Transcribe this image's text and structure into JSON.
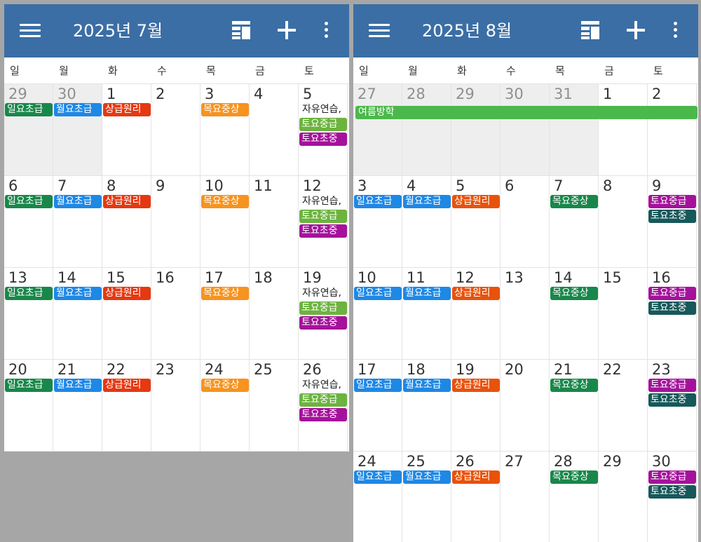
{
  "colors": {
    "app_bar": "#3b6ea5",
    "other_month_bg": "#eeeeee",
    "outer_bg": "#a6a6a6",
    "grid_line": "#e3e3e3"
  },
  "icons": [
    "menu-icon",
    "view-layout-icon",
    "add-icon",
    "more-vert-icon"
  ],
  "weekdays": [
    "일",
    "월",
    "화",
    "수",
    "목",
    "금",
    "토"
  ],
  "event_colors": {
    "일요초급": "#19874a",
    "월요초급": "#1e88e5",
    "상급원리": "#e53912",
    "목요중상": "#f7931e",
    "자유연습,": "#ffffff",
    "토요중급": "#6cb33f",
    "토요초중": "#a4129b",
    "여름방학": "#4bb84b"
  },
  "months": [
    {
      "title": "2025년 7월",
      "weeks": [
        [
          {
            "day": "29",
            "other": true,
            "events": [
              "일요초급"
            ]
          },
          {
            "day": "30",
            "other": true,
            "events": [
              "월요초급"
            ]
          },
          {
            "day": "1",
            "events": [
              "상급원리"
            ]
          },
          {
            "day": "2",
            "events": []
          },
          {
            "day": "3",
            "events": [
              "목요중상"
            ]
          },
          {
            "day": "4",
            "events": []
          },
          {
            "day": "5",
            "events": [
              "자유연습,",
              "토요중급",
              "토요초중"
            ]
          }
        ],
        [
          {
            "day": "6",
            "events": [
              "일요초급"
            ]
          },
          {
            "day": "7",
            "events": [
              "월요초급"
            ]
          },
          {
            "day": "8",
            "events": [
              "상급원리"
            ]
          },
          {
            "day": "9",
            "events": []
          },
          {
            "day": "10",
            "events": [
              "목요중상"
            ]
          },
          {
            "day": "11",
            "events": []
          },
          {
            "day": "12",
            "events": [
              "자유연습,",
              "토요중급",
              "토요초중"
            ]
          }
        ],
        [
          {
            "day": "13",
            "events": [
              "일요초급"
            ]
          },
          {
            "day": "14",
            "events": [
              "월요초급"
            ]
          },
          {
            "day": "15",
            "events": [
              "상급원리"
            ]
          },
          {
            "day": "16",
            "events": []
          },
          {
            "day": "17",
            "events": [
              "목요중상"
            ]
          },
          {
            "day": "18",
            "events": []
          },
          {
            "day": "19",
            "events": [
              "자유연습,",
              "토요중급",
              "토요초중"
            ]
          }
        ],
        [
          {
            "day": "20",
            "events": [
              "일요초급"
            ]
          },
          {
            "day": "21",
            "events": [
              "월요초급"
            ]
          },
          {
            "day": "22",
            "events": [
              "상급원리"
            ]
          },
          {
            "day": "23",
            "events": []
          },
          {
            "day": "24",
            "events": [
              "목요중상"
            ]
          },
          {
            "day": "25",
            "events": []
          },
          {
            "day": "26",
            "events": [
              "자유연습,",
              "토요중급",
              "토요초중"
            ]
          }
        ],
        [
          {
            "day": "",
            "events": []
          },
          {
            "day": "",
            "events": []
          },
          {
            "day": "",
            "events": []
          },
          {
            "day": "",
            "events": []
          },
          {
            "day": "",
            "events": []
          },
          {
            "day": "",
            "events": []
          },
          {
            "day": "",
            "events": []
          }
        ]
      ]
    },
    {
      "title": "2025년 8월",
      "spanning_event": {
        "label": "여름방학",
        "color": "#4bb84b"
      },
      "event_color_overrides": {
        "일요초급": "#1e88e5",
        "상급원리": "#e8520c",
        "목요중상": "#19874a",
        "토요중급": "#a4129b",
        "토요초중": "#17585a"
      },
      "weeks": [
        [
          {
            "day": "27",
            "other": true,
            "events": []
          },
          {
            "day": "28",
            "other": true,
            "events": []
          },
          {
            "day": "29",
            "other": true,
            "events": []
          },
          {
            "day": "30",
            "other": true,
            "events": []
          },
          {
            "day": "31",
            "other": true,
            "events": []
          },
          {
            "day": "1",
            "events": []
          },
          {
            "day": "2",
            "events": []
          }
        ],
        [
          {
            "day": "3",
            "events": [
              "일요초급"
            ]
          },
          {
            "day": "4",
            "events": [
              "월요초급"
            ]
          },
          {
            "day": "5",
            "events": [
              "상급원리"
            ]
          },
          {
            "day": "6",
            "events": []
          },
          {
            "day": "7",
            "events": [
              "목요중상"
            ]
          },
          {
            "day": "8",
            "events": []
          },
          {
            "day": "9",
            "events": [
              "토요중급",
              "토요초중"
            ]
          }
        ],
        [
          {
            "day": "10",
            "events": [
              "일요초급"
            ]
          },
          {
            "day": "11",
            "events": [
              "월요초급"
            ]
          },
          {
            "day": "12",
            "events": [
              "상급원리"
            ]
          },
          {
            "day": "13",
            "events": []
          },
          {
            "day": "14",
            "events": [
              "목요중상"
            ]
          },
          {
            "day": "15",
            "events": []
          },
          {
            "day": "16",
            "events": [
              "토요중급",
              "토요초중"
            ]
          }
        ],
        [
          {
            "day": "17",
            "events": [
              "일요초급"
            ]
          },
          {
            "day": "18",
            "events": [
              "월요초급"
            ]
          },
          {
            "day": "19",
            "events": [
              "상급원리"
            ]
          },
          {
            "day": "20",
            "events": []
          },
          {
            "day": "21",
            "events": [
              "목요중상"
            ]
          },
          {
            "day": "22",
            "events": []
          },
          {
            "day": "23",
            "events": [
              "토요중급",
              "토요초중"
            ]
          }
        ],
        [
          {
            "day": "24",
            "events": [
              "일요초급"
            ]
          },
          {
            "day": "25",
            "events": [
              "월요초급"
            ]
          },
          {
            "day": "26",
            "events": [
              "상급원리"
            ]
          },
          {
            "day": "27",
            "events": []
          },
          {
            "day": "28",
            "events": [
              "목요중상"
            ]
          },
          {
            "day": "29",
            "events": []
          },
          {
            "day": "30",
            "events": [
              "토요중급",
              "토요초중"
            ]
          }
        ]
      ]
    }
  ]
}
